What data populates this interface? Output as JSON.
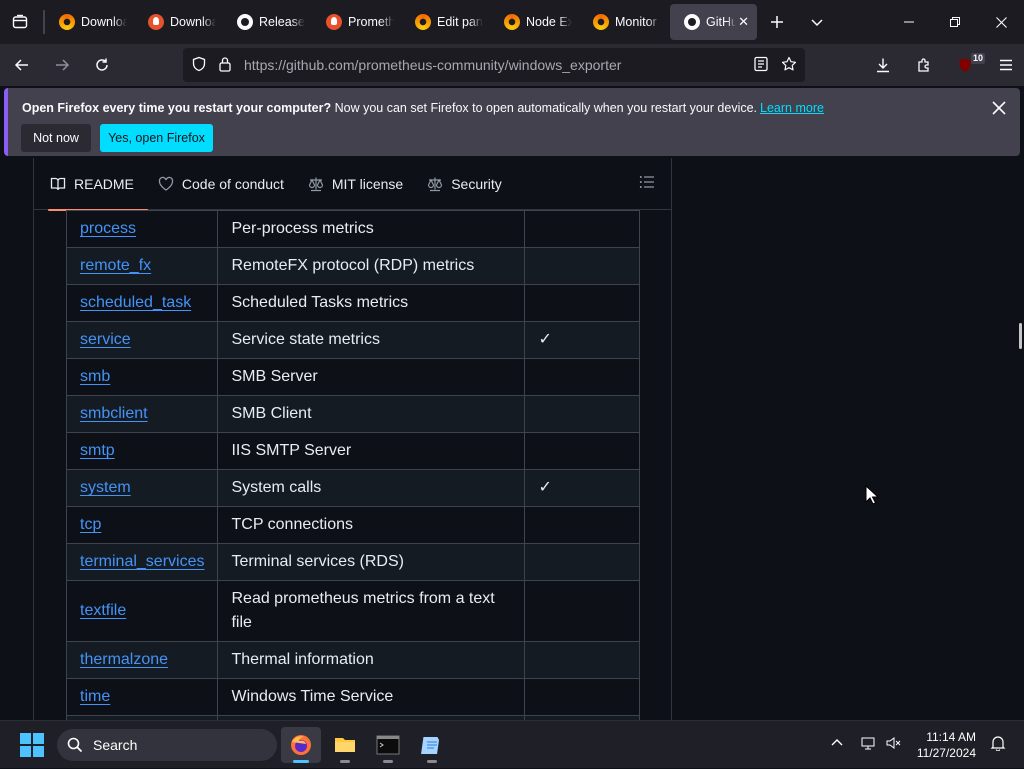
{
  "browser": {
    "tabs": [
      {
        "label": "Downloads",
        "icon": "grafana-icon"
      },
      {
        "label": "Downloads",
        "icon": "prometheus-icon"
      },
      {
        "label": "Release",
        "icon": "github-icon"
      },
      {
        "label": "Prometheus",
        "icon": "prometheus-icon"
      },
      {
        "label": "Edit panel",
        "icon": "grafana-icon"
      },
      {
        "label": "Node Exporter",
        "icon": "grafana-icon"
      },
      {
        "label": "Monitor",
        "icon": "grafana-icon"
      },
      {
        "label": "GitHub",
        "icon": "github-icon"
      }
    ],
    "url_host": "https://github.com",
    "url_path": "/prometheus-community/windows_exporter",
    "extensions_badge": "10"
  },
  "notification": {
    "bold": "Open Firefox every time you restart your computer?",
    "text": " Now you can set Firefox to open automatically when you restart your device.",
    "link": "Learn more",
    "not_now": "Not now",
    "yes": "Yes, open Firefox"
  },
  "readme_tabs": [
    {
      "label": "README",
      "icon": "book-icon"
    },
    {
      "label": "Code of conduct",
      "icon": "heart-icon"
    },
    {
      "label": "MIT license",
      "icon": "law-icon"
    },
    {
      "label": "Security",
      "icon": "law-icon"
    }
  ],
  "collectors": [
    {
      "name": "process",
      "description": "Per-process metrics",
      "default": ""
    },
    {
      "name": "remote_fx",
      "description": "RemoteFX protocol (RDP) metrics",
      "default": ""
    },
    {
      "name": "scheduled_task",
      "description": "Scheduled Tasks metrics",
      "default": ""
    },
    {
      "name": "service",
      "description": "Service state metrics",
      "default": "✓"
    },
    {
      "name": "smb",
      "description": "SMB Server",
      "default": ""
    },
    {
      "name": "smbclient",
      "description": "SMB Client",
      "default": ""
    },
    {
      "name": "smtp",
      "description": "IIS SMTP Server",
      "default": ""
    },
    {
      "name": "system",
      "description": "System calls",
      "default": "✓"
    },
    {
      "name": "tcp",
      "description": "TCP connections",
      "default": ""
    },
    {
      "name": "terminal_services",
      "description": "Terminal services (RDS)",
      "default": ""
    },
    {
      "name": "textfile",
      "description": "Read prometheus metrics from a text file",
      "default": ""
    },
    {
      "name": "thermalzone",
      "description": "Thermal information",
      "default": ""
    },
    {
      "name": "time",
      "description": "Windows Time Service",
      "default": ""
    }
  ],
  "taskbar": {
    "search_placeholder": "Search",
    "time": "11:14 AM",
    "date": "11/27/2024"
  }
}
